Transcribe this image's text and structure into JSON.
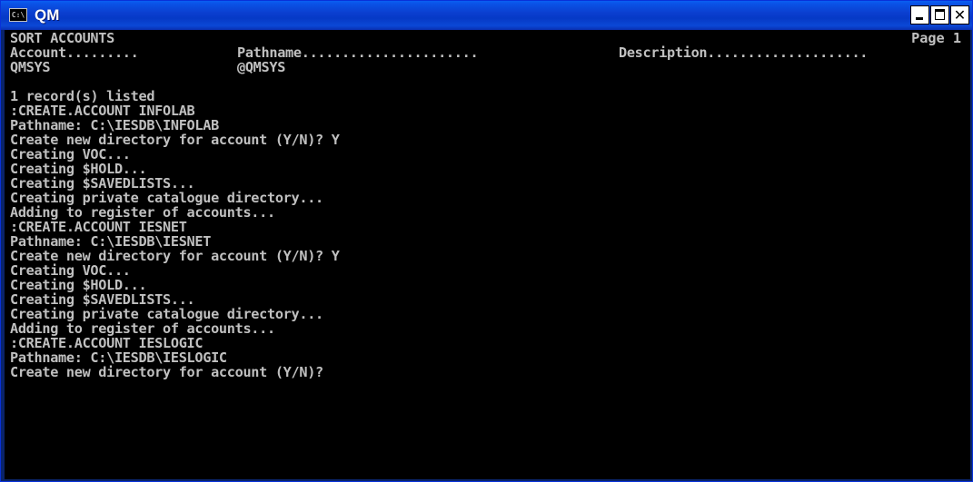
{
  "window": {
    "title": "QM",
    "icon_text": "C:\\"
  },
  "controls": {
    "minimize": "minimize-icon",
    "maximize": "maximize-icon",
    "close": "close-icon"
  },
  "report": {
    "title": "SORT ACCOUNTS",
    "page_label": "Page 1",
    "columns": [
      "Account.........",
      "Pathname......................",
      "Description...................."
    ],
    "rows": [
      {
        "account": "QMSYS",
        "pathname": "@QMSYS",
        "description": ""
      }
    ]
  },
  "console": {
    "lines": [
      "",
      "1 record(s) listed",
      ":CREATE.ACCOUNT INFOLAB",
      "Pathname: C:\\IESDB\\INFOLAB",
      "Create new directory for account (Y/N)? Y",
      "Creating VOC...",
      "Creating $HOLD...",
      "Creating $SAVEDLISTS...",
      "Creating private catalogue directory...",
      "Adding to register of accounts...",
      ":CREATE.ACCOUNT IESNET",
      "Pathname: C:\\IESDB\\IESNET",
      "Create new directory for account (Y/N)? Y",
      "Creating VOC...",
      "Creating $HOLD...",
      "Creating $SAVEDLISTS...",
      "Creating private catalogue directory...",
      "Adding to register of accounts...",
      ":CREATE.ACCOUNT IESLOGIC",
      "Pathname: C:\\IESDB\\IESLOGIC",
      "Create new directory for account (Y/N)?"
    ]
  },
  "colors": {
    "titlebar": "#0b3fd0",
    "console_bg": "#000000",
    "console_fg": "#c0c0c0"
  }
}
